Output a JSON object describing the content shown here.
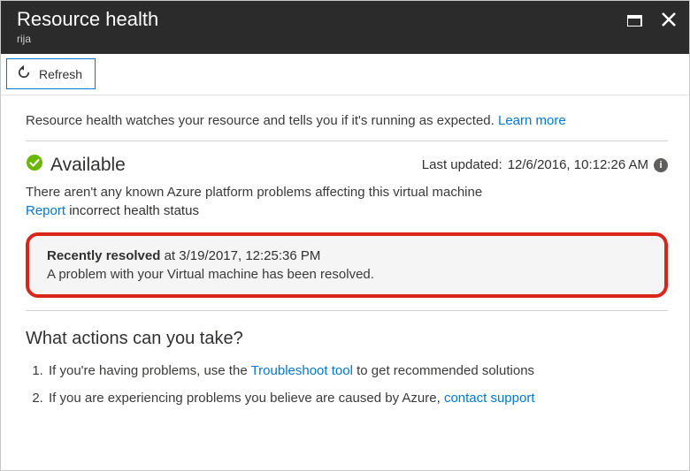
{
  "titlebar": {
    "title": "Resource health",
    "subtitle": "rija"
  },
  "toolbar": {
    "refresh_label": "Refresh"
  },
  "intro": {
    "text": "Resource health watches your resource and tells you if it's running as expected. ",
    "learn_more": "Learn more"
  },
  "status": {
    "state": "Available",
    "last_updated_label": "Last updated:",
    "last_updated_value": "12/6/2016, 10:12:26 AM",
    "message": "There aren't any known Azure platform problems affecting this virtual machine",
    "report_link": "Report",
    "report_rest": " incorrect health status"
  },
  "resolved": {
    "label": "Recently resolved",
    "at": " at 3/19/2017, 12:25:36 PM",
    "message": "A problem with your Virtual machine has been resolved."
  },
  "actions": {
    "heading": "What actions can you take?",
    "items": [
      {
        "pre": "If you're having problems, use the ",
        "link": "Troubleshoot tool",
        "post": " to get recommended solutions"
      },
      {
        "pre": "If you are experiencing problems you believe are caused by Azure, ",
        "link": "contact support",
        "post": ""
      }
    ]
  }
}
